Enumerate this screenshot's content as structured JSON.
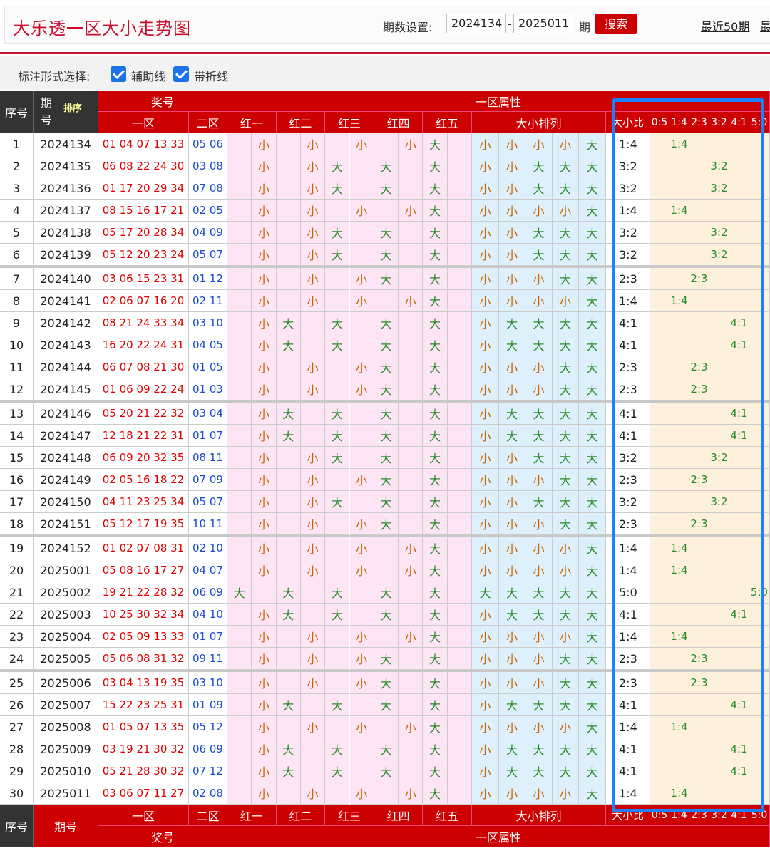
{
  "header": {
    "title": "大乐透一区大小走势图",
    "period_label": "期数设置:",
    "start_period": "2024134",
    "dash": "-",
    "end_period": "2025011",
    "period_unit": "期",
    "search_label": "搜索",
    "recent50_label": "最近50期",
    "recent_more_label": "最"
  },
  "options": {
    "label": "标注形式选择:",
    "assist_line": "辅助线",
    "fold_line": "带折线"
  },
  "table": {
    "h_seq": "序号",
    "h_period": "期号",
    "h_sort": "排序",
    "h_award": "奖号",
    "h_zone1": "一区",
    "h_zone2": "二区",
    "h_attr": "一区属性",
    "reds": [
      "红一",
      "红二",
      "红三",
      "红四",
      "红五"
    ],
    "h_order": "大小排列",
    "h_ratio": "大小比",
    "ratio_cols": [
      "0:5",
      "1:4",
      "2:3",
      "3:2",
      "4:1",
      "5:0"
    ],
    "foot_seq": "序号",
    "foot_period": "期号",
    "foot_zone1": "一区",
    "foot_zone2": "二区",
    "foot_award": "奖号",
    "foot_attr": "一区属性",
    "rows": [
      {
        "n": "1",
        "p": "2024134",
        "z1": "01 04 07 13 33",
        "z2": "05 06",
        "red": [
          "小",
          "小",
          "小",
          "小",
          "大"
        ],
        "ord": [
          "小",
          "小",
          "小",
          "小",
          "大"
        ],
        "r": "1:4"
      },
      {
        "n": "2",
        "p": "2024135",
        "z1": "06 08 22 24 30",
        "z2": "03 08",
        "red": [
          "小",
          "小",
          "大",
          "大",
          "大"
        ],
        "ord": [
          "小",
          "小",
          "大",
          "大",
          "大"
        ],
        "r": "3:2"
      },
      {
        "n": "3",
        "p": "2024136",
        "z1": "01 17 20 29 34",
        "z2": "07 08",
        "red": [
          "小",
          "小",
          "大",
          "大",
          "大"
        ],
        "ord": [
          "小",
          "小",
          "大",
          "大",
          "大"
        ],
        "r": "3:2"
      },
      {
        "n": "4",
        "p": "2024137",
        "z1": "08 15 16 17 21",
        "z2": "02 05",
        "red": [
          "小",
          "小",
          "小",
          "小",
          "大"
        ],
        "ord": [
          "小",
          "小",
          "小",
          "小",
          "大"
        ],
        "r": "1:4"
      },
      {
        "n": "5",
        "p": "2024138",
        "z1": "05 17 20 28 34",
        "z2": "04 09",
        "red": [
          "小",
          "小",
          "大",
          "大",
          "大"
        ],
        "ord": [
          "小",
          "小",
          "大",
          "大",
          "大"
        ],
        "r": "3:2"
      },
      {
        "n": "6",
        "p": "2024139",
        "z1": "05 12 20 23 24",
        "z2": "05 07",
        "red": [
          "小",
          "小",
          "大",
          "大",
          "大"
        ],
        "ord": [
          "小",
          "小",
          "大",
          "大",
          "大"
        ],
        "r": "3:2"
      },
      {
        "n": "7",
        "p": "2024140",
        "z1": "03 06 15 23 31",
        "z2": "01 12",
        "red": [
          "小",
          "小",
          "小",
          "大",
          "大"
        ],
        "ord": [
          "小",
          "小",
          "小",
          "大",
          "大"
        ],
        "r": "2:3"
      },
      {
        "n": "8",
        "p": "2024141",
        "z1": "02 06 07 16 20",
        "z2": "02 11",
        "red": [
          "小",
          "小",
          "小",
          "小",
          "大"
        ],
        "ord": [
          "小",
          "小",
          "小",
          "小",
          "大"
        ],
        "r": "1:4"
      },
      {
        "n": "9",
        "p": "2024142",
        "z1": "08 21 24 33 34",
        "z2": "03 10",
        "red": [
          "小",
          "大",
          "大",
          "大",
          "大"
        ],
        "ord": [
          "小",
          "大",
          "大",
          "大",
          "大"
        ],
        "r": "4:1"
      },
      {
        "n": "10",
        "p": "2024143",
        "z1": "16 20 22 24 31",
        "z2": "04 05",
        "red": [
          "小",
          "大",
          "大",
          "大",
          "大"
        ],
        "ord": [
          "小",
          "大",
          "大",
          "大",
          "大"
        ],
        "r": "4:1"
      },
      {
        "n": "11",
        "p": "2024144",
        "z1": "06 07 08 21 30",
        "z2": "01 05",
        "red": [
          "小",
          "小",
          "小",
          "大",
          "大"
        ],
        "ord": [
          "小",
          "小",
          "小",
          "大",
          "大"
        ],
        "r": "2:3"
      },
      {
        "n": "12",
        "p": "2024145",
        "z1": "01 06 09 22 24",
        "z2": "01 03",
        "red": [
          "小",
          "小",
          "小",
          "大",
          "大"
        ],
        "ord": [
          "小",
          "小",
          "小",
          "大",
          "大"
        ],
        "r": "2:3"
      },
      {
        "n": "13",
        "p": "2024146",
        "z1": "05 20 21 22 32",
        "z2": "03 04",
        "red": [
          "小",
          "大",
          "大",
          "大",
          "大"
        ],
        "ord": [
          "小",
          "大",
          "大",
          "大",
          "大"
        ],
        "r": "4:1"
      },
      {
        "n": "14",
        "p": "2024147",
        "z1": "12 18 21 22 31",
        "z2": "01 07",
        "red": [
          "小",
          "大",
          "大",
          "大",
          "大"
        ],
        "ord": [
          "小",
          "大",
          "大",
          "大",
          "大"
        ],
        "r": "4:1"
      },
      {
        "n": "15",
        "p": "2024148",
        "z1": "06 09 20 32 35",
        "z2": "08 11",
        "red": [
          "小",
          "小",
          "大",
          "大",
          "大"
        ],
        "ord": [
          "小",
          "小",
          "大",
          "大",
          "大"
        ],
        "r": "3:2"
      },
      {
        "n": "16",
        "p": "2024149",
        "z1": "02 05 16 18 22",
        "z2": "07 09",
        "red": [
          "小",
          "小",
          "小",
          "大",
          "大"
        ],
        "ord": [
          "小",
          "小",
          "小",
          "大",
          "大"
        ],
        "r": "2:3"
      },
      {
        "n": "17",
        "p": "2024150",
        "z1": "04 11 23 25 34",
        "z2": "05 07",
        "red": [
          "小",
          "小",
          "大",
          "大",
          "大"
        ],
        "ord": [
          "小",
          "小",
          "大",
          "大",
          "大"
        ],
        "r": "3:2"
      },
      {
        "n": "18",
        "p": "2024151",
        "z1": "05 12 17 19 35",
        "z2": "10 11",
        "red": [
          "小",
          "小",
          "小",
          "大",
          "大"
        ],
        "ord": [
          "小",
          "小",
          "小",
          "大",
          "大"
        ],
        "r": "2:3"
      },
      {
        "n": "19",
        "p": "2024152",
        "z1": "01 02 07 08 31",
        "z2": "02 10",
        "red": [
          "小",
          "小",
          "小",
          "小",
          "大"
        ],
        "ord": [
          "小",
          "小",
          "小",
          "小",
          "大"
        ],
        "r": "1:4"
      },
      {
        "n": "20",
        "p": "2025001",
        "z1": "05 08 16 17 27",
        "z2": "04 07",
        "red": [
          "小",
          "小",
          "小",
          "小",
          "大"
        ],
        "ord": [
          "小",
          "小",
          "小",
          "小",
          "大"
        ],
        "r": "1:4"
      },
      {
        "n": "21",
        "p": "2025002",
        "z1": "19 21 22 28 32",
        "z2": "06 09",
        "red": [
          "大",
          "大",
          "大",
          "大",
          "大"
        ],
        "ord": [
          "大",
          "大",
          "大",
          "大",
          "大"
        ],
        "r": "5:0"
      },
      {
        "n": "22",
        "p": "2025003",
        "z1": "10 25 30 32 34",
        "z2": "04 10",
        "red": [
          "小",
          "大",
          "大",
          "大",
          "大"
        ],
        "ord": [
          "小",
          "大",
          "大",
          "大",
          "大"
        ],
        "r": "4:1"
      },
      {
        "n": "23",
        "p": "2025004",
        "z1": "02 05 09 13 33",
        "z2": "01 07",
        "red": [
          "小",
          "小",
          "小",
          "小",
          "大"
        ],
        "ord": [
          "小",
          "小",
          "小",
          "小",
          "大"
        ],
        "r": "1:4"
      },
      {
        "n": "24",
        "p": "2025005",
        "z1": "05 06 08 31 32",
        "z2": "09 11",
        "red": [
          "小",
          "小",
          "小",
          "大",
          "大"
        ],
        "ord": [
          "小",
          "小",
          "小",
          "大",
          "大"
        ],
        "r": "2:3"
      },
      {
        "n": "25",
        "p": "2025006",
        "z1": "03 04 13 19 35",
        "z2": "03 10",
        "red": [
          "小",
          "小",
          "小",
          "大",
          "大"
        ],
        "ord": [
          "小",
          "小",
          "小",
          "大",
          "大"
        ],
        "r": "2:3"
      },
      {
        "n": "26",
        "p": "2025007",
        "z1": "15 22 23 25 31",
        "z2": "01 09",
        "red": [
          "小",
          "大",
          "大",
          "大",
          "大"
        ],
        "ord": [
          "小",
          "大",
          "大",
          "大",
          "大"
        ],
        "r": "4:1"
      },
      {
        "n": "27",
        "p": "2025008",
        "z1": "01 05 07 13 35",
        "z2": "05 12",
        "red": [
          "小",
          "小",
          "小",
          "小",
          "大"
        ],
        "ord": [
          "小",
          "小",
          "小",
          "小",
          "大"
        ],
        "r": "1:4"
      },
      {
        "n": "28",
        "p": "2025009",
        "z1": "03 19 21 30 32",
        "z2": "06 09",
        "red": [
          "小",
          "大",
          "大",
          "大",
          "大"
        ],
        "ord": [
          "小",
          "大",
          "大",
          "大",
          "大"
        ],
        "r": "4:1"
      },
      {
        "n": "29",
        "p": "2025010",
        "z1": "05 21 28 30 32",
        "z2": "07 12",
        "red": [
          "小",
          "大",
          "大",
          "大",
          "大"
        ],
        "ord": [
          "小",
          "大",
          "大",
          "大",
          "大"
        ],
        "r": "4:1"
      },
      {
        "n": "30",
        "p": "2025011",
        "z1": "03 06 07 11 27",
        "z2": "02 08",
        "red": [
          "小",
          "小",
          "小",
          "小",
          "大"
        ],
        "ord": [
          "小",
          "小",
          "小",
          "小",
          "大"
        ],
        "r": "1:4"
      }
    ]
  },
  "colors": {
    "brand_red": "#c8102e",
    "header_red": "#cc0000",
    "small_text": "#c86400",
    "big_text": "#2a8a2a",
    "pink_bg": "#fde5f5",
    "blue_bg": "#ddf0fb",
    "ratio_bg": "#fdf1de",
    "highlight": "#1a82ff"
  }
}
